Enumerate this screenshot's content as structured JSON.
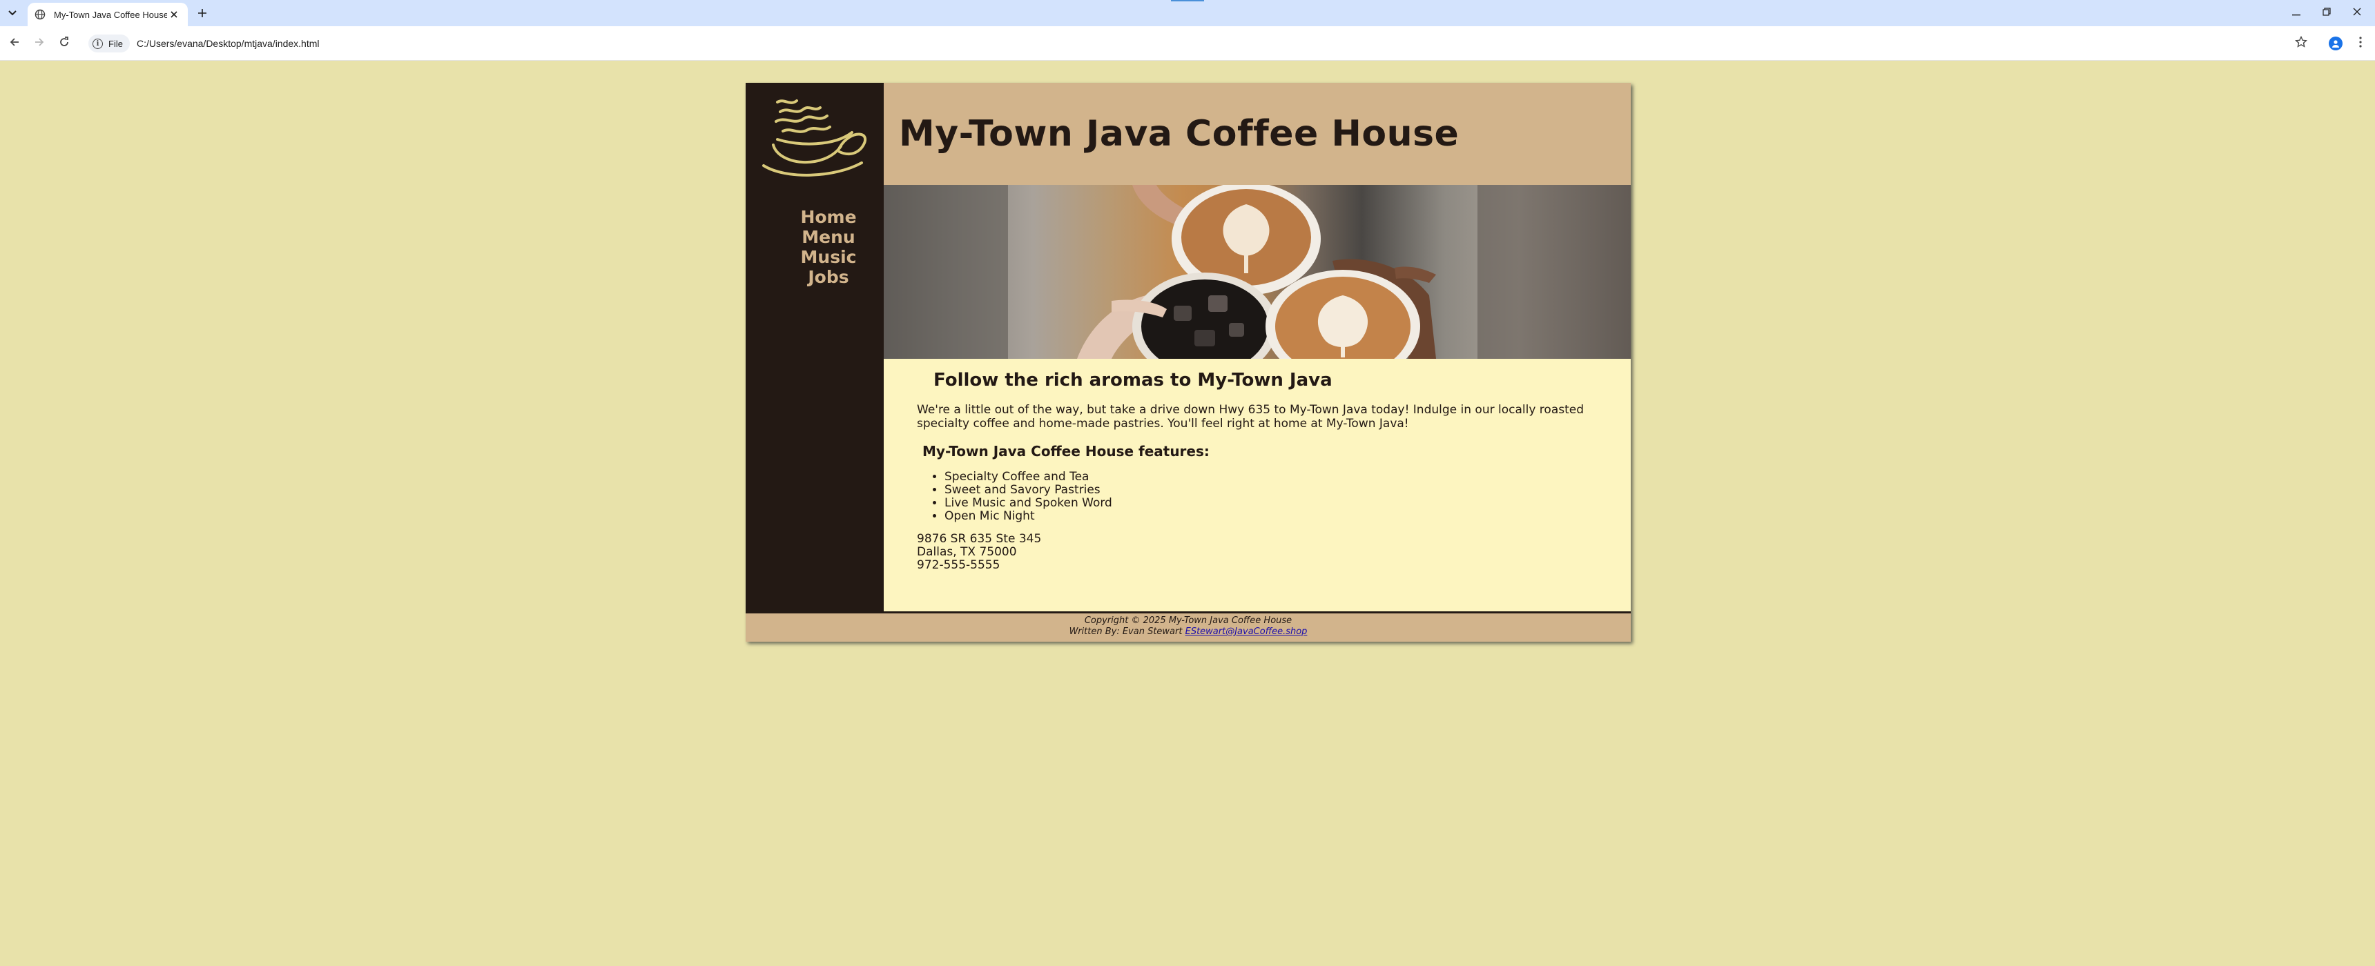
{
  "browser": {
    "tab_title": "My-Town Java Coffee House",
    "site_chip_label": "File",
    "url": "C:/Users/evana/Desktop/mtjava/index.html",
    "icons": {
      "tab_list": "chevron-down-icon",
      "favicon": "globe-icon",
      "tab_close": "close-icon",
      "new_tab": "plus-icon",
      "back": "back-arrow-icon",
      "forward": "forward-arrow-icon",
      "reload": "reload-icon",
      "info": "info-icon",
      "bookmark": "star-icon",
      "profile": "profile-icon",
      "menu": "kebab-menu-icon",
      "minimize": "minimize-icon",
      "restore": "restore-icon",
      "close": "close-icon"
    }
  },
  "site": {
    "title": "My-Town Java Coffee House",
    "nav": [
      "Home",
      "Menu",
      "Music",
      "Jobs"
    ],
    "heading": "Follow the rich aromas to My-Town Java",
    "intro": "We're a little out of the way, but take a drive down Hwy 635 to My-Town Java today! Indulge in our locally roasted specialty coffee and home-made pastries. You'll feel right at home at My-Town Java!",
    "features_heading": "My-Town Java Coffee House features:",
    "features": [
      "Specialty Coffee and Tea",
      "Sweet and Savory Pastries",
      "Live Music and Spoken Word",
      "Open Mic Night"
    ],
    "address": {
      "street": "9876 SR 635 Ste 345",
      "city": "Dallas, TX 75000",
      "phone": "972-555-5555"
    },
    "footer": {
      "copyright": "Copyright © 2025 My-Town Java Coffee House",
      "written_by": "Written By: Evan Stewart",
      "email": "EStewart@JavaCoffee.shop"
    }
  },
  "colors": {
    "page_bg": "#e8e2aa",
    "sidebar": "#231914",
    "header_tan": "#d2b48c",
    "content_bg": "#fdf5c0",
    "logo_gold": "#d9c97a",
    "tab_strip": "#d3e3fd"
  }
}
